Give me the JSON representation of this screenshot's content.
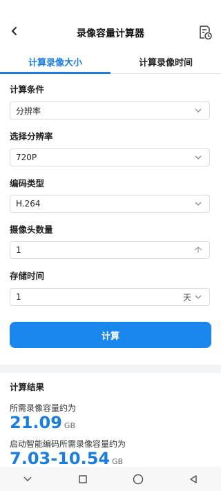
{
  "header": {
    "title": "录像容量计算器"
  },
  "tabs": [
    {
      "label": "计算录像大小",
      "active": true
    },
    {
      "label": "计算录像时间",
      "active": false
    }
  ],
  "form": {
    "condition": {
      "label": "计算条件",
      "value": "分辨率"
    },
    "resolution": {
      "label": "选择分辨率",
      "value": "720P"
    },
    "encoding": {
      "label": "编码类型",
      "value": "H.264"
    },
    "cameras": {
      "label": "摄像头数量",
      "value": "1"
    },
    "storage": {
      "label": "存储时间",
      "value": "1",
      "unit": "天"
    }
  },
  "calc_button": "计算",
  "results": {
    "title": "计算结果",
    "required_label": "所需录像容量约为",
    "required_value": "21.09",
    "required_unit": "GB",
    "smart_label": "启动智能编码所需录像容量约为",
    "smart_value": "7.03-10.54",
    "smart_unit": "GB"
  },
  "colors": {
    "accent": "#1a7de3",
    "button": "#1a87ee"
  },
  "icons": {
    "back": "back-arrow-icon",
    "history": "history-doc-icon",
    "dropdown": "chevron-down-icon",
    "stepper": "chevron-up-icon"
  }
}
